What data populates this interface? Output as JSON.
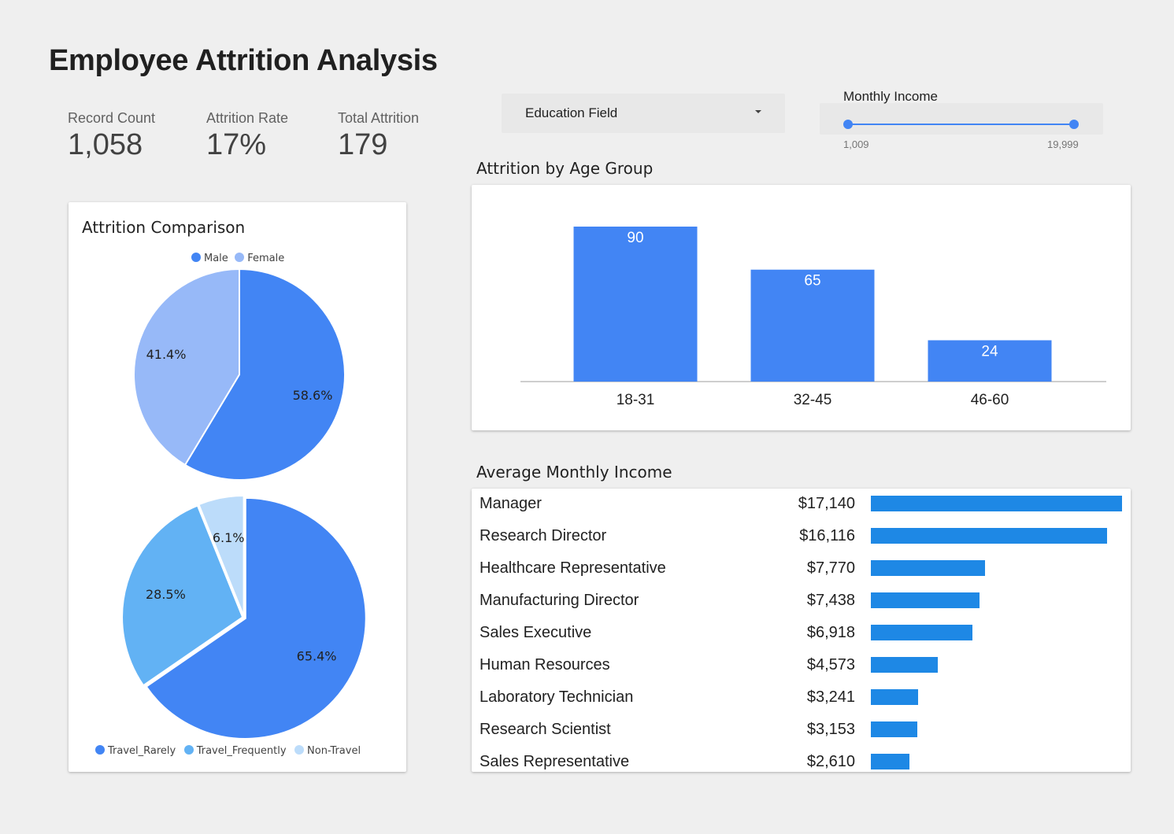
{
  "page": {
    "title": "Employee Attrition Analysis"
  },
  "kpis": [
    {
      "label": "Record Count",
      "value": "1,058"
    },
    {
      "label": "Attrition Rate",
      "value": "17%"
    },
    {
      "label": "Total Attrition",
      "value": "179"
    }
  ],
  "filters": {
    "education_field": {
      "label": "Education Field",
      "icon": "chevron-down-icon"
    },
    "monthly_income": {
      "title": "Monthly Income",
      "min_label": "1,009",
      "max_label": "19,999",
      "min": 1009,
      "max": 19999,
      "low": 1009,
      "high": 19999
    }
  },
  "colors": {
    "accent": "#4285f4",
    "bar_income": "#1e88e5",
    "female": "#97b9f8",
    "travel_frequently": "#62b2f4",
    "non_travel": "#bcdcfa",
    "background": "#efefef"
  },
  "attrition_comparison": {
    "title": "Attrition Comparison",
    "gender_legend": [
      "Male",
      "Female"
    ],
    "travel_legend": [
      "Travel_Rarely",
      "Travel_Frequently",
      "Non-Travel"
    ]
  },
  "age_group": {
    "title": "Attrition by Age Group"
  },
  "income": {
    "title": "Average Monthly Income",
    "rows": [
      {
        "name": "Manager",
        "value_label": "$17,140",
        "value": 17140
      },
      {
        "name": "Research Director",
        "value_label": "$16,116",
        "value": 16116
      },
      {
        "name": "Healthcare Representative",
        "value_label": "$7,770",
        "value": 7770
      },
      {
        "name": "Manufacturing Director",
        "value_label": "$7,438",
        "value": 7438
      },
      {
        "name": "Sales Executive",
        "value_label": "$6,918",
        "value": 6918
      },
      {
        "name": "Human Resources",
        "value_label": "$4,573",
        "value": 4573
      },
      {
        "name": "Laboratory Technician",
        "value_label": "$3,241",
        "value": 3241
      },
      {
        "name": "Research Scientist",
        "value_label": "$3,153",
        "value": 3153
      },
      {
        "name": "Sales Representative",
        "value_label": "$2,610",
        "value": 2610
      }
    ]
  },
  "chart_data": [
    {
      "type": "pie",
      "categories": [
        "Male",
        "Female"
      ],
      "values": [
        58.6,
        41.4
      ],
      "data_labels": [
        "58.6%",
        "41.4%"
      ],
      "colors": [
        "#4285f4",
        "#97b9f8"
      ],
      "legend": "top"
    },
    {
      "type": "pie",
      "categories": [
        "Travel_Rarely",
        "Travel_Frequently",
        "Non-Travel"
      ],
      "values": [
        65.4,
        28.5,
        6.1
      ],
      "data_labels": [
        "65.4%",
        "28.5%",
        "6.1%"
      ],
      "colors": [
        "#4285f4",
        "#62b2f4",
        "#bcdcfa"
      ],
      "legend": "bottom"
    },
    {
      "type": "bar",
      "categories": [
        "18-31",
        "32-45",
        "46-60"
      ],
      "values": [
        90,
        65,
        24
      ],
      "ylim": [
        0,
        90
      ],
      "grid": false
    },
    {
      "type": "bar",
      "orientation": "horizontal",
      "categories": [
        "Manager",
        "Research Director",
        "Healthcare Representative",
        "Manufacturing Director",
        "Sales Executive",
        "Human Resources",
        "Laboratory Technician",
        "Research Scientist",
        "Sales Representative"
      ],
      "values": [
        17140,
        16116,
        7770,
        7438,
        6918,
        4573,
        3241,
        3153,
        2610
      ],
      "xlim": [
        0,
        17140
      ]
    }
  ]
}
